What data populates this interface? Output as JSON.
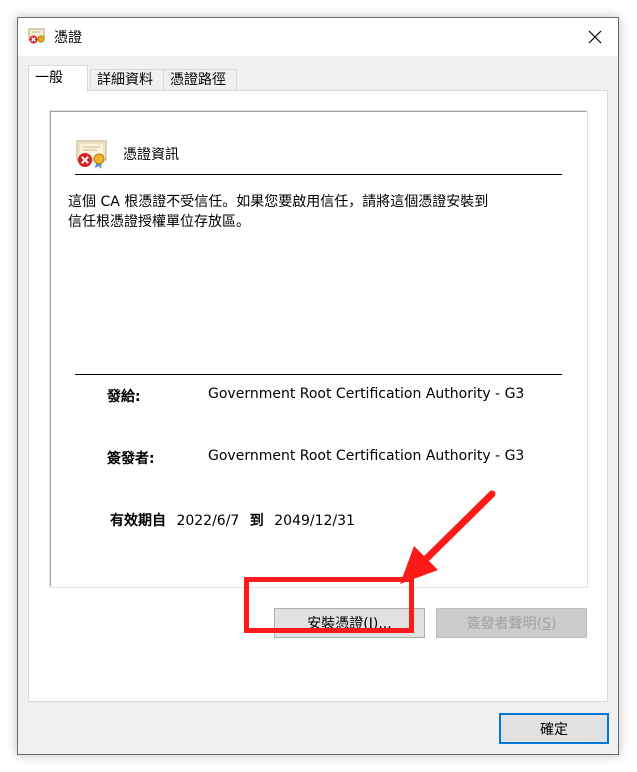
{
  "window": {
    "title": "憑證",
    "close_icon": "close-icon",
    "title_icon": "certificate-error-icon"
  },
  "tabs": [
    {
      "label": "一般",
      "active": true
    },
    {
      "label": "詳細資料",
      "active": false
    },
    {
      "label": "憑證路徑",
      "active": false
    }
  ],
  "info": {
    "heading": "憑證資訊",
    "message_line1": "這個 CA 根憑證不受信任。如果您要啟用信任，請將這個憑證安裝到",
    "message_line2": "信任根憑證授權單位存放區。",
    "issued_to_label": "發給:",
    "issued_to_value": "Government Root Certification Authority - G3",
    "issued_by_label": "簽發者:",
    "issued_by_value": "Government Root Certification Authority - G3",
    "valid_from_label": "有效期自",
    "valid_from": "2022/6/7",
    "valid_to_label": "到",
    "valid_to": "2049/12/31"
  },
  "buttons": {
    "install_prefix": "安裝憑證(",
    "install_key": "I",
    "install_suffix": ")...",
    "statement_prefix": "簽發者聲明(",
    "statement_key": "S",
    "statement_suffix": ")",
    "ok_label": "確定"
  },
  "colors": {
    "highlight": "#ff1a1a",
    "accent": "#0078d7"
  }
}
